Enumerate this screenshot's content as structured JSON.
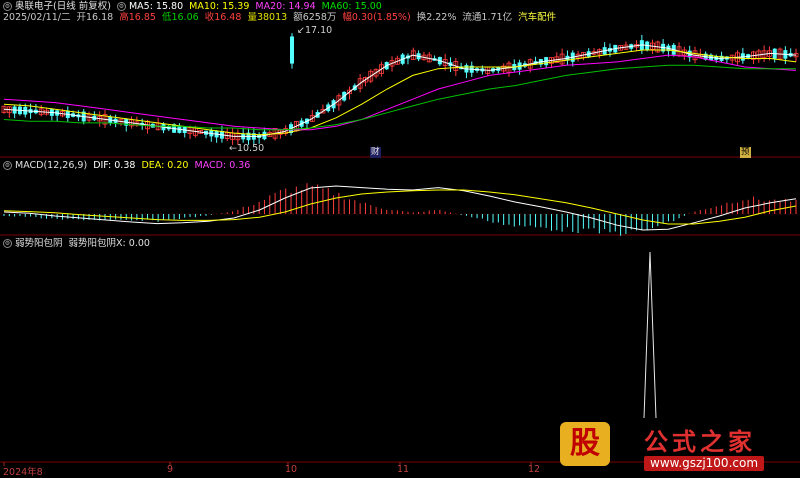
{
  "header": {
    "line1": {
      "title": "奥联电子(日线 前复权)",
      "ma5_label": "MA5: 15.80",
      "ma10_label": "MA10: 15.39",
      "ma20_label": "MA20: 14.94",
      "ma60_label": "MA60: 15.00"
    },
    "line2": {
      "date": "2025/02/11/二",
      "open": "开16.18",
      "high": "高16.85",
      "low": "低16.06",
      "close": "收16.48",
      "volume": "量38013",
      "amount": "额6258万",
      "change": "幅0.30(1.85%)",
      "turnover": "换2.22%",
      "float": "流通1.71亿",
      "sector": "汽车配件"
    }
  },
  "price_chart": {
    "high_label": "17.10",
    "low_label": "10.50",
    "badge_cai": "财",
    "badge_yu": "预"
  },
  "macd_header": {
    "title": "MACD(12,26,9)",
    "dif": "DIF: 0.38",
    "dea": "DEA: 0.20",
    "macd": "MACD: 0.36"
  },
  "indicator_header": {
    "title": "弱势阳包阴",
    "value": "弱势阳包阴X: 0.00"
  },
  "x_axis": {
    "labels": [
      "2024年8",
      "9",
      "10",
      "11",
      "12"
    ]
  },
  "watermark": {
    "gu": "股",
    "title": "公式之家",
    "url": "www.gszj100.com"
  },
  "colors": {
    "up": "#ff3c3c",
    "down": "#54ffff",
    "ma5": "#ffffff",
    "ma10": "#ffff00",
    "ma20": "#ff00ff",
    "ma60": "#00c000",
    "grid": "#7a0000"
  },
  "chart_data": [
    {
      "type": "candlestick",
      "title": "奥联电子(日线 前复权)",
      "series": [
        {
          "name": "MA5",
          "values": [
            12.6,
            12.5,
            12.4,
            12.2,
            12.0,
            11.8,
            11.6,
            11.4,
            11.2,
            11.0,
            11.0,
            11.3,
            12.0,
            13.0,
            14.2,
            15.2,
            15.8,
            15.5,
            15.0,
            14.9,
            15.1,
            15.4,
            15.6,
            15.9,
            16.2,
            16.4,
            16.2,
            15.8,
            15.6,
            15.7,
            15.9,
            15.8
          ]
        },
        {
          "name": "MA10",
          "values": [
            12.9,
            12.8,
            12.6,
            12.4,
            12.2,
            12.0,
            11.8,
            11.6,
            11.4,
            11.2,
            11.1,
            11.2,
            11.5,
            12.1,
            12.9,
            13.8,
            14.6,
            15.0,
            15.1,
            15.1,
            15.1,
            15.3,
            15.5,
            15.7,
            15.9,
            16.1,
            16.1,
            15.9,
            15.7,
            15.6,
            15.6,
            15.4
          ]
        },
        {
          "name": "MA20",
          "values": [
            13.2,
            13.1,
            13.0,
            12.8,
            12.6,
            12.4,
            12.2,
            12.0,
            11.8,
            11.6,
            11.5,
            11.4,
            11.4,
            11.6,
            12.0,
            12.6,
            13.2,
            13.8,
            14.2,
            14.6,
            14.8,
            15.0,
            15.2,
            15.3,
            15.4,
            15.6,
            15.8,
            15.7,
            15.4,
            15.1,
            15.0,
            14.9
          ]
        },
        {
          "name": "MA60",
          "values": [
            12.0,
            11.9,
            11.9,
            11.8,
            11.8,
            11.7,
            11.6,
            11.6,
            11.5,
            11.5,
            11.4,
            11.4,
            11.5,
            11.7,
            12.0,
            12.4,
            12.8,
            13.2,
            13.5,
            13.8,
            14.0,
            14.3,
            14.6,
            14.8,
            15.0,
            15.1,
            15.2,
            15.2,
            15.1,
            15.0,
            15.0,
            15.0
          ]
        }
      ],
      "high_marker": 17.1,
      "low_marker": 10.5
    },
    {
      "type": "bar",
      "title": "MACD(12,26,9)",
      "series": [
        {
          "name": "DIF",
          "values": [
            0.05,
            0.02,
            -0.05,
            -0.1,
            -0.15,
            -0.2,
            -0.24,
            -0.22,
            -0.18,
            -0.1,
            0.1,
            0.4,
            0.65,
            0.7,
            0.66,
            0.62,
            0.6,
            0.66,
            0.58,
            0.45,
            0.3,
            0.18,
            0.05,
            -0.1,
            -0.28,
            -0.4,
            -0.38,
            -0.22,
            -0.05,
            0.15,
            0.28,
            0.38
          ]
        },
        {
          "name": "DEA",
          "values": [
            0.08,
            0.06,
            0.03,
            -0.02,
            -0.06,
            -0.1,
            -0.14,
            -0.16,
            -0.16,
            -0.14,
            -0.08,
            0.05,
            0.25,
            0.4,
            0.5,
            0.55,
            0.58,
            0.6,
            0.6,
            0.55,
            0.48,
            0.38,
            0.28,
            0.15,
            0.0,
            -0.15,
            -0.25,
            -0.25,
            -0.18,
            -0.08,
            0.08,
            0.2
          ]
        },
        {
          "name": "MACD",
          "values": [
            -0.06,
            -0.08,
            -0.16,
            -0.16,
            -0.18,
            -0.2,
            -0.2,
            -0.12,
            -0.04,
            0.08,
            0.36,
            0.7,
            0.8,
            0.6,
            0.32,
            0.14,
            0.04,
            0.12,
            -0.04,
            -0.2,
            -0.36,
            -0.4,
            -0.46,
            -0.5,
            -0.56,
            -0.5,
            -0.26,
            0.06,
            0.26,
            0.46,
            0.4,
            0.36
          ]
        }
      ]
    },
    {
      "type": "line",
      "title": "弱势阳包阴",
      "series": [
        {
          "name": "弱势阳包阴X",
          "values": [
            0,
            0,
            0,
            0,
            0,
            0,
            0,
            0,
            0,
            0,
            0,
            0,
            0,
            0,
            0,
            0,
            0,
            0,
            0,
            0,
            0,
            0,
            0,
            0,
            0,
            0,
            1,
            0,
            0,
            0,
            0,
            0
          ]
        }
      ]
    }
  ]
}
